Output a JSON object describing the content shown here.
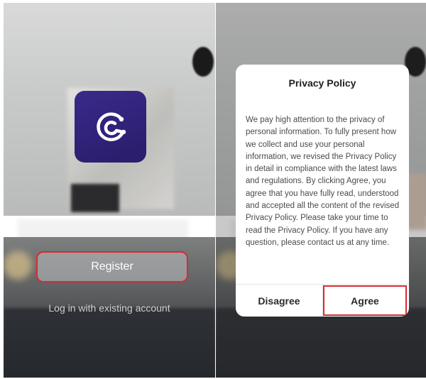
{
  "left_screen": {
    "register_label": "Register",
    "login_label": "Log in with existing account",
    "logo_icon": "app-logo-c-icon"
  },
  "right_screen": {
    "dialog": {
      "title": "Privacy Policy",
      "body": "We pay high attention to the privacy of personal information. To fully present how we collect and use your personal information, we revised the Privacy Policy in detail in compliance with the latest laws and regulations. By clicking Agree, you agree that you have fully read, understood and accepted all the content of the revised Privacy Policy. Please take your time to read the Privacy Policy. If you have any question, please contact us at any time.",
      "disagree_label": "Disagree",
      "agree_label": "Agree"
    }
  },
  "colors": {
    "highlight": "#d82a33",
    "logo_bg": "#2f2178",
    "link": "#3f8ad8"
  }
}
